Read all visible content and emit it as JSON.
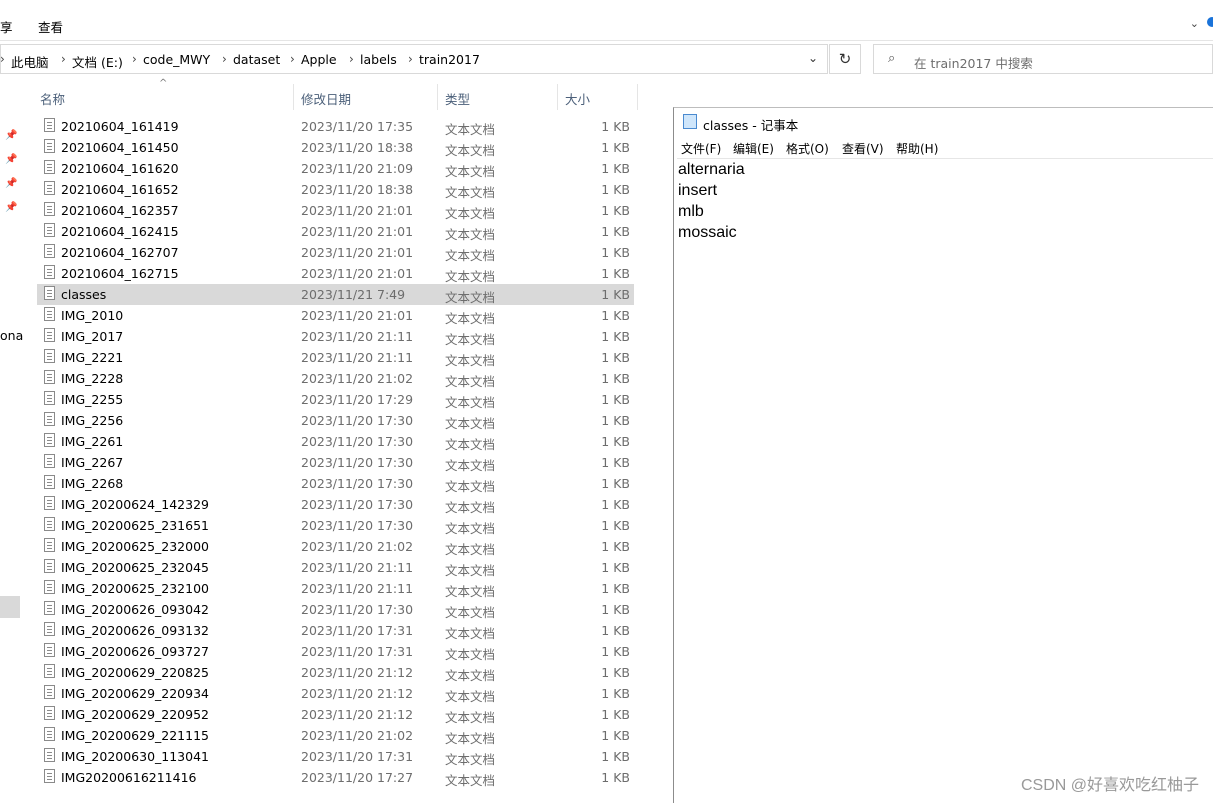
{
  "ribbon": {
    "tab_share": "享",
    "tab_view": "查看"
  },
  "address": {
    "crumbs": [
      "此电脑",
      "文档 (E:)",
      "code_MWY",
      "dataset",
      "Apple",
      "labels",
      "train2017"
    ],
    "dropdown_icon": "chevron-down-icon",
    "refresh_icon": "refresh-icon"
  },
  "search": {
    "placeholder": "在 train2017 中搜索",
    "icon": "search-icon"
  },
  "navpane": {
    "partial_text": "ona"
  },
  "columns": {
    "name": "名称",
    "date": "修改日期",
    "type": "类型",
    "size": "大小"
  },
  "files": [
    {
      "name": "20210604_161419",
      "date": "2023/11/20 17:35",
      "type": "文本文档",
      "size": "1 KB"
    },
    {
      "name": "20210604_161450",
      "date": "2023/11/20 18:38",
      "type": "文本文档",
      "size": "1 KB"
    },
    {
      "name": "20210604_161620",
      "date": "2023/11/20 21:09",
      "type": "文本文档",
      "size": "1 KB"
    },
    {
      "name": "20210604_161652",
      "date": "2023/11/20 18:38",
      "type": "文本文档",
      "size": "1 KB"
    },
    {
      "name": "20210604_162357",
      "date": "2023/11/20 21:01",
      "type": "文本文档",
      "size": "1 KB"
    },
    {
      "name": "20210604_162415",
      "date": "2023/11/20 21:01",
      "type": "文本文档",
      "size": "1 KB"
    },
    {
      "name": "20210604_162707",
      "date": "2023/11/20 21:01",
      "type": "文本文档",
      "size": "1 KB"
    },
    {
      "name": "20210604_162715",
      "date": "2023/11/20 21:01",
      "type": "文本文档",
      "size": "1 KB"
    },
    {
      "name": "classes",
      "date": "2023/11/21 7:49",
      "type": "文本文档",
      "size": "1 KB",
      "selected": true
    },
    {
      "name": "IMG_2010",
      "date": "2023/11/20 21:01",
      "type": "文本文档",
      "size": "1 KB"
    },
    {
      "name": "IMG_2017",
      "date": "2023/11/20 21:11",
      "type": "文本文档",
      "size": "1 KB"
    },
    {
      "name": "IMG_2221",
      "date": "2023/11/20 21:11",
      "type": "文本文档",
      "size": "1 KB"
    },
    {
      "name": "IMG_2228",
      "date": "2023/11/20 21:02",
      "type": "文本文档",
      "size": "1 KB"
    },
    {
      "name": "IMG_2255",
      "date": "2023/11/20 17:29",
      "type": "文本文档",
      "size": "1 KB"
    },
    {
      "name": "IMG_2256",
      "date": "2023/11/20 17:30",
      "type": "文本文档",
      "size": "1 KB"
    },
    {
      "name": "IMG_2261",
      "date": "2023/11/20 17:30",
      "type": "文本文档",
      "size": "1 KB"
    },
    {
      "name": "IMG_2267",
      "date": "2023/11/20 17:30",
      "type": "文本文档",
      "size": "1 KB"
    },
    {
      "name": "IMG_2268",
      "date": "2023/11/20 17:30",
      "type": "文本文档",
      "size": "1 KB"
    },
    {
      "name": "IMG_20200624_142329",
      "date": "2023/11/20 17:30",
      "type": "文本文档",
      "size": "1 KB"
    },
    {
      "name": "IMG_20200625_231651",
      "date": "2023/11/20 17:30",
      "type": "文本文档",
      "size": "1 KB"
    },
    {
      "name": "IMG_20200625_232000",
      "date": "2023/11/20 21:02",
      "type": "文本文档",
      "size": "1 KB"
    },
    {
      "name": "IMG_20200625_232045",
      "date": "2023/11/20 21:11",
      "type": "文本文档",
      "size": "1 KB"
    },
    {
      "name": "IMG_20200625_232100",
      "date": "2023/11/20 21:11",
      "type": "文本文档",
      "size": "1 KB"
    },
    {
      "name": "IMG_20200626_093042",
      "date": "2023/11/20 17:30",
      "type": "文本文档",
      "size": "1 KB"
    },
    {
      "name": "IMG_20200626_093132",
      "date": "2023/11/20 17:31",
      "type": "文本文档",
      "size": "1 KB"
    },
    {
      "name": "IMG_20200626_093727",
      "date": "2023/11/20 17:31",
      "type": "文本文档",
      "size": "1 KB"
    },
    {
      "name": "IMG_20200629_220825",
      "date": "2023/11/20 21:12",
      "type": "文本文档",
      "size": "1 KB"
    },
    {
      "name": "IMG_20200629_220934",
      "date": "2023/11/20 21:12",
      "type": "文本文档",
      "size": "1 KB"
    },
    {
      "name": "IMG_20200629_220952",
      "date": "2023/11/20 21:12",
      "type": "文本文档",
      "size": "1 KB"
    },
    {
      "name": "IMG_20200629_221115",
      "date": "2023/11/20 21:02",
      "type": "文本文档",
      "size": "1 KB"
    },
    {
      "name": "IMG_20200630_113041",
      "date": "2023/11/20 17:31",
      "type": "文本文档",
      "size": "1 KB"
    },
    {
      "name": "IMG20200616211416",
      "date": "2023/11/20 17:27",
      "type": "文本文档",
      "size": "1 KB"
    }
  ],
  "notepad": {
    "title": "classes - 记事本",
    "menu": [
      "文件(F)",
      "编辑(E)",
      "格式(O)",
      "查看(V)",
      "帮助(H)"
    ],
    "lines": [
      "alternaria",
      "insert",
      "mlb",
      "mossaic"
    ]
  },
  "watermark": "CSDN @好喜欢吃红柚子",
  "colors": {
    "selected_row": "#d9d9d9",
    "header_text": "#4c607a",
    "muted_text": "#6d6d6d"
  }
}
